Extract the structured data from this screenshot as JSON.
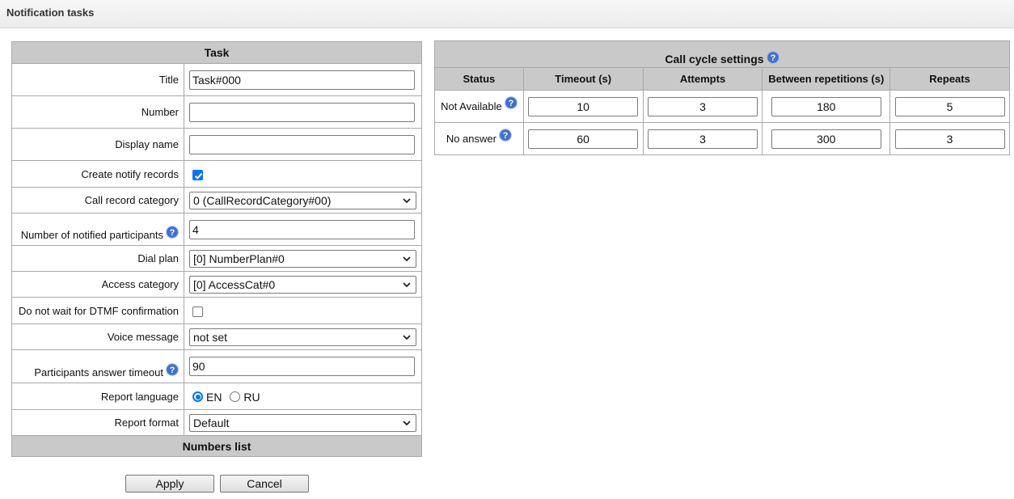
{
  "page": {
    "title": "Notification tasks"
  },
  "task": {
    "header": "Task",
    "fields": {
      "title": {
        "label": "Title",
        "value": "Task#000"
      },
      "number": {
        "label": "Number",
        "value": ""
      },
      "display_name": {
        "label": "Display name",
        "value": ""
      },
      "create_notify_records": {
        "label": "Create notify records",
        "checked": true
      },
      "call_record_category": {
        "label": "Call record category",
        "value": "0 (CallRecordCategory#00)"
      },
      "notified_participants": {
        "label": "Number of notified participants",
        "value": "4"
      },
      "dial_plan": {
        "label": "Dial plan",
        "value": "[0] NumberPlan#0"
      },
      "access_category": {
        "label": "Access category",
        "value": "[0] AccessCat#0"
      },
      "no_dtmf_wait": {
        "label": "Do not wait for DTMF confirmation",
        "checked": false
      },
      "voice_message": {
        "label": "Voice message",
        "value": "not set"
      },
      "answer_timeout": {
        "label": "Participants answer timeout",
        "value": "90"
      },
      "report_language": {
        "label": "Report language",
        "options": [
          "EN",
          "RU"
        ],
        "selected": "EN"
      },
      "report_format": {
        "label": "Report format",
        "value": "Default"
      }
    },
    "numbers_list_header": "Numbers list"
  },
  "call_cycle": {
    "header": "Call cycle settings",
    "columns": [
      "Status",
      "Timeout (s)",
      "Attempts",
      "Between repetitions (s)",
      "Repeats"
    ],
    "rows": [
      {
        "status": "Not Available",
        "timeout": "10",
        "attempts": "3",
        "between": "180",
        "repeats": "5"
      },
      {
        "status": "No answer",
        "timeout": "60",
        "attempts": "3",
        "between": "300",
        "repeats": "3"
      }
    ]
  },
  "buttons": {
    "apply": "Apply",
    "cancel": "Cancel"
  },
  "icons": {
    "help": "help-icon",
    "chevron": "chevron-down-icon",
    "check": "check-icon"
  },
  "colors": {
    "header_bg": "#c9c9c9",
    "accent": "#0075ff",
    "help_icon": "#3d6fd6"
  }
}
